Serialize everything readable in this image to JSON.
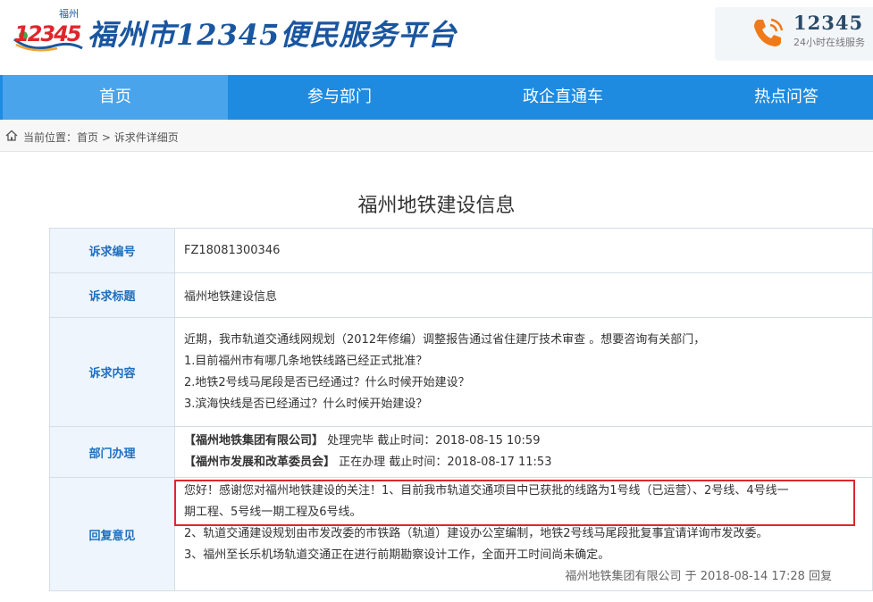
{
  "header": {
    "logo_city": "福州",
    "logo_number": "12345",
    "site_title": "福州市12345便民服务平台",
    "hotline_number": "12345",
    "hotline_sub": "24小时在线服务",
    "colors": {
      "brand_blue": "#1a56a0",
      "brand_red": "#e0262b",
      "nav_blue": "#1e8be0"
    }
  },
  "nav": {
    "items": [
      {
        "label": "首页",
        "active": true
      },
      {
        "label": "参与部门",
        "active": false
      },
      {
        "label": "政企直通车",
        "active": false
      },
      {
        "label": "热点问答",
        "active": false
      }
    ]
  },
  "breadcrumb": {
    "prefix": "当前位置：",
    "home": "首页",
    "separator": ">",
    "current": "诉求件详细页"
  },
  "page_title": "福州地铁建设信息",
  "detail": {
    "id_label": "诉求编号",
    "id_value": "FZ18081300346",
    "subject_label": "诉求标题",
    "subject_value": "福州地铁建设信息",
    "content_label": "诉求内容",
    "content_lines": [
      "近期，我市轨道交通线网规划（2012年修编）调整报告通过省住建厅技术审查 。想要咨询有关部门，",
      "1.目前福州市有哪几条地铁线路已经正式批准？",
      "2.地铁2号线马尾段是否已经通过？什么时候开始建设？",
      "3.滨海快线是否已经通过？什么时候开始建设？"
    ],
    "dept_label": "部门办理",
    "depts": [
      {
        "name": "【福州地铁集团有限公司】",
        "status": "处理完毕",
        "deadline_label": "截止时间：",
        "deadline": "2018-08-15 10:59"
      },
      {
        "name": "【福州市发展和改革委员会】",
        "status": "正在办理",
        "deadline_label": "截止时间：",
        "deadline": "2018-08-17 11:53"
      }
    ],
    "reply_label": "回复意见",
    "reply_lines": [
      "您好！感谢您对福州地铁建设的关注！1、目前我市轨道交通项目中已获批的线路为1号线（已运营）、2号线、4号线一",
      "期工程、5号线一期工程及6号线。",
      "2、轨道交通建设规划由市发改委的市铁路（轨道）建设办公室编制，地铁2号线马尾段批复事宜请详询市发改委。",
      "3、福州至长乐机场轨道交通正在进行前期勘察设计工作，全面开工时间尚未确定。"
    ],
    "reply_signature": "福州地铁集团有限公司 于 2018-08-14 17:28 回复"
  }
}
